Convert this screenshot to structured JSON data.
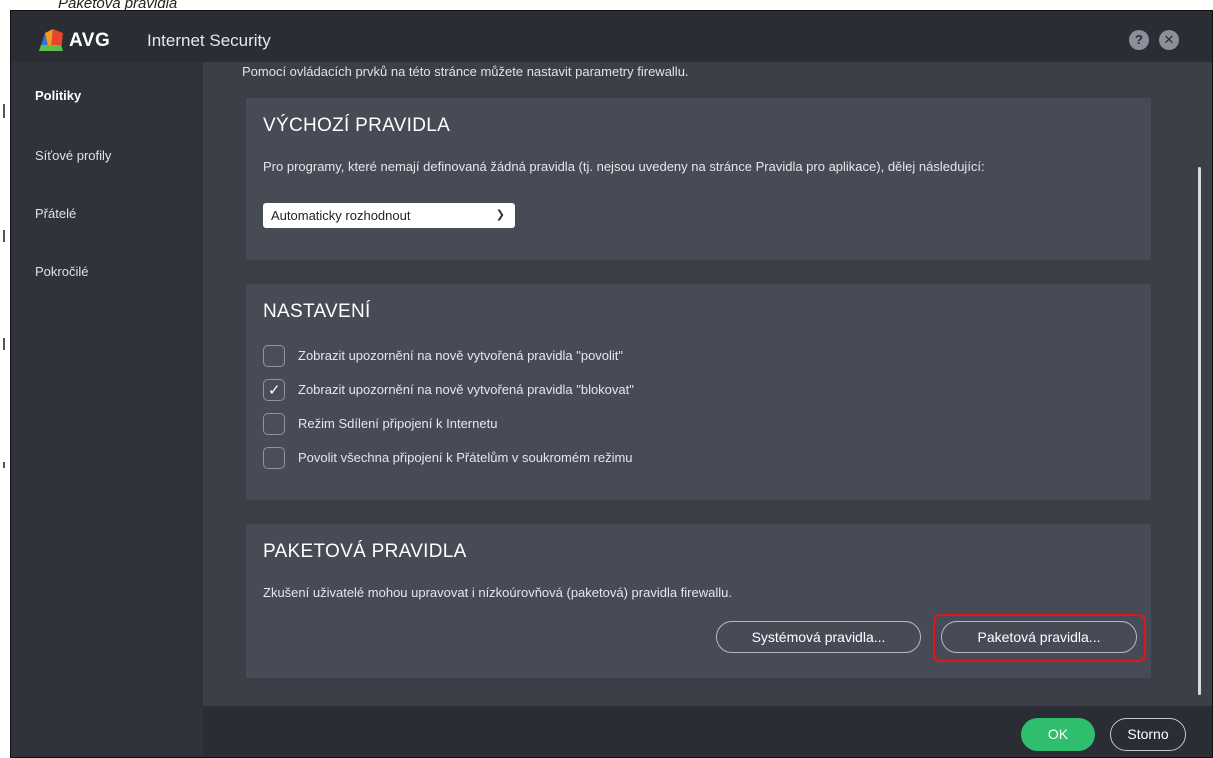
{
  "document": {
    "caption": "Paketová pravidla"
  },
  "window": {
    "brand": "AVG",
    "product": "Internet Security",
    "help_label": "?",
    "close_label": "✕"
  },
  "sidebar": {
    "items": [
      {
        "label": "Politiky",
        "active": true
      },
      {
        "label": "Síťové profily"
      },
      {
        "label": "Přátelé"
      },
      {
        "label": "Pokročilé"
      }
    ]
  },
  "main": {
    "intro": "Pomocí ovládacích prvků na této stránce můžete nastavit parametry firewallu.",
    "default_rules": {
      "title": "VÝCHOZÍ PRAVIDLA",
      "description": "Pro programy, které nemají definovaná žádná pravidla (tj. nejsou uvedeny na stránce Pravidla pro aplikace), dělej následující:",
      "select_value": "Automaticky rozhodnout"
    },
    "settings": {
      "title": "NASTAVENÍ",
      "options": [
        {
          "label": "Zobrazit upozornění na nově vytvořená pravidla \"povolit\"",
          "checked": false,
          "mark": ""
        },
        {
          "label": "Zobrazit upozornění na nově vytvořená pravidla \"blokovat\"",
          "checked": true,
          "mark": "✓"
        },
        {
          "label": "Režim Sdílení připojení k Internetu",
          "checked": false,
          "mark": ""
        },
        {
          "label": "Povolit všechna připojení k Přátelům v soukromém režimu",
          "checked": false,
          "mark": ""
        }
      ]
    },
    "packet_rules": {
      "title": "PAKETOVÁ PRAVIDLA",
      "description": "Zkušení uživatelé mohou upravovat i nízkoúrovňová (paketová) pravidla firewallu.",
      "system_rules_button": "Systémová pravidla...",
      "packet_rules_button": "Paketová pravidla..."
    }
  },
  "footer": {
    "ok_label": "OK",
    "cancel_label": "Storno"
  },
  "colors": {
    "accent_green": "#2fbd6e",
    "highlight_red": "#e0161c",
    "panel_bg": "#474b55",
    "window_bg": "#3b3f48"
  }
}
